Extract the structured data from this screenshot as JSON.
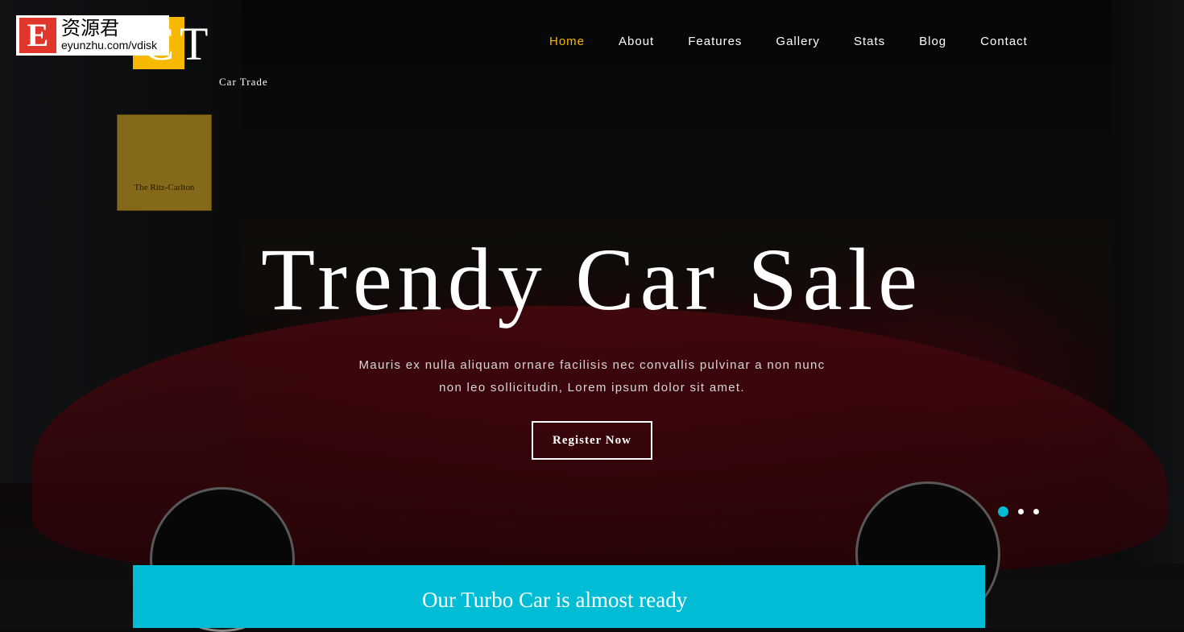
{
  "watermark": {
    "letter": "E",
    "chinese": "资源君",
    "url": "eyunzhu.com/vdisk"
  },
  "logo": {
    "letters": "CT",
    "tagline": "Car Trade",
    "color": "#f6b800"
  },
  "background_sign": "The Ritz-Carlton",
  "nav": {
    "items": [
      {
        "label": "Home",
        "active": true
      },
      {
        "label": "About"
      },
      {
        "label": "Features"
      },
      {
        "label": "Gallery"
      },
      {
        "label": "Stats"
      },
      {
        "label": "Blog"
      },
      {
        "label": "Contact"
      }
    ]
  },
  "hero": {
    "title": "Trendy Car Sale",
    "subtitle": "Mauris ex nulla aliquam ornare facilisis nec convallis pulvinar a non nunc non leo sollicitudin, Lorem ipsum dolor sit amet.",
    "button": "Register Now"
  },
  "slider": {
    "count": 3,
    "active": 1,
    "accent": "#00bcd4"
  },
  "banner": {
    "text": "Our Turbo Car is almost ready",
    "color": "#00bcd4"
  }
}
